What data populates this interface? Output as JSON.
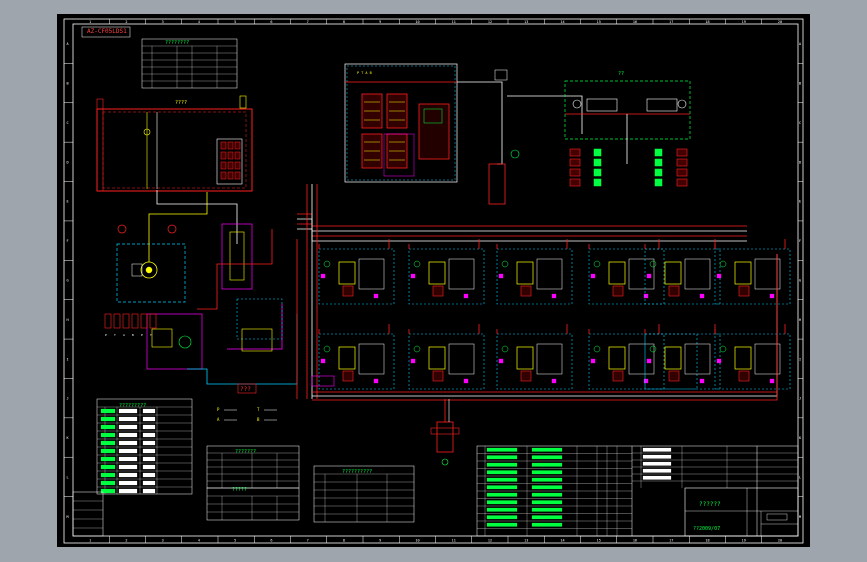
{
  "drawing": {
    "code_label": "AZ-CF05LDS1",
    "center_label": "????",
    "pump_label": "???",
    "motor_label": "??",
    "title_text": "??????",
    "sheet_code": "??2009/07"
  },
  "zones": {
    "columns": [
      "1",
      "2",
      "3",
      "4",
      "5",
      "6",
      "7",
      "8",
      "9",
      "10",
      "11",
      "12",
      "13",
      "14",
      "15",
      "16",
      "17",
      "18",
      "19",
      "20"
    ],
    "rows": [
      "A",
      "B",
      "C",
      "D",
      "E",
      "F",
      "G",
      "H",
      "I",
      "J",
      "K",
      "L",
      "M"
    ]
  },
  "tables": {
    "top": {
      "title": "????????",
      "rows": 7
    },
    "left": {
      "title": "?????????",
      "rows": 11
    },
    "middle": {
      "title": "???????",
      "rows": 6
    },
    "right_mid": {
      "title": "??????????",
      "rows": 6
    },
    "legend_small": {
      "title": "?????",
      "rows": 3
    }
  },
  "symbols": [
    "P",
    "T",
    "A",
    "B"
  ],
  "colors": {
    "frame": "#ffffff",
    "pressure_line": "#ff2020",
    "return_line": "#ffffff",
    "pilot_line": "#00d0ff",
    "component": "#ffff00",
    "accent_green": "#00ff40",
    "magenta": "#ff00ff"
  }
}
